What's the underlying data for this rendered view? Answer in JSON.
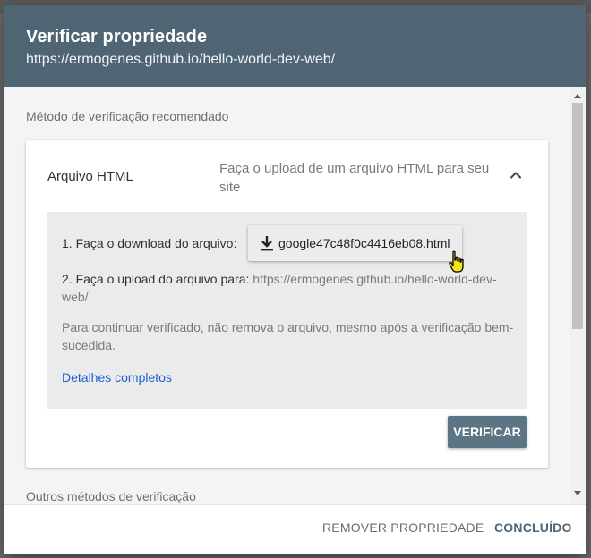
{
  "dialog": {
    "title": "Verificar propriedade",
    "subtitle": "https://ermogenes.github.io/hello-world-dev-web/"
  },
  "body": {
    "section_label": "Método de verificação recomendado",
    "method": {
      "name": "Arquivo HTML",
      "description": "Faça o upload de um arquivo HTML para seu site",
      "expand_icon": "chevron-up-icon"
    },
    "steps": {
      "step1_label": "1. Faça o download do arquivo:",
      "download_filename": "google47c48f0c4416eb08.html",
      "download_icon": "download-icon",
      "step2_label": "2. Faça o upload do arquivo para:",
      "step2_url": "https://ermogenes.github.io/hello-world-dev-web/"
    },
    "note": "Para continuar verificado, não remova o arquivo, mesmo após a verificação bem-sucedida.",
    "details_link": "Detalhes completos",
    "verify_button": "VERIFICAR",
    "other_methods_label": "Outros métodos de verificação"
  },
  "footer": {
    "remove_button": "REMOVER PROPRIEDADE",
    "done_button": "CONCLUÍDO"
  },
  "colors": {
    "header_bg": "#4f6574",
    "verify_bg": "#5c7584",
    "link": "#1a5fd6"
  }
}
